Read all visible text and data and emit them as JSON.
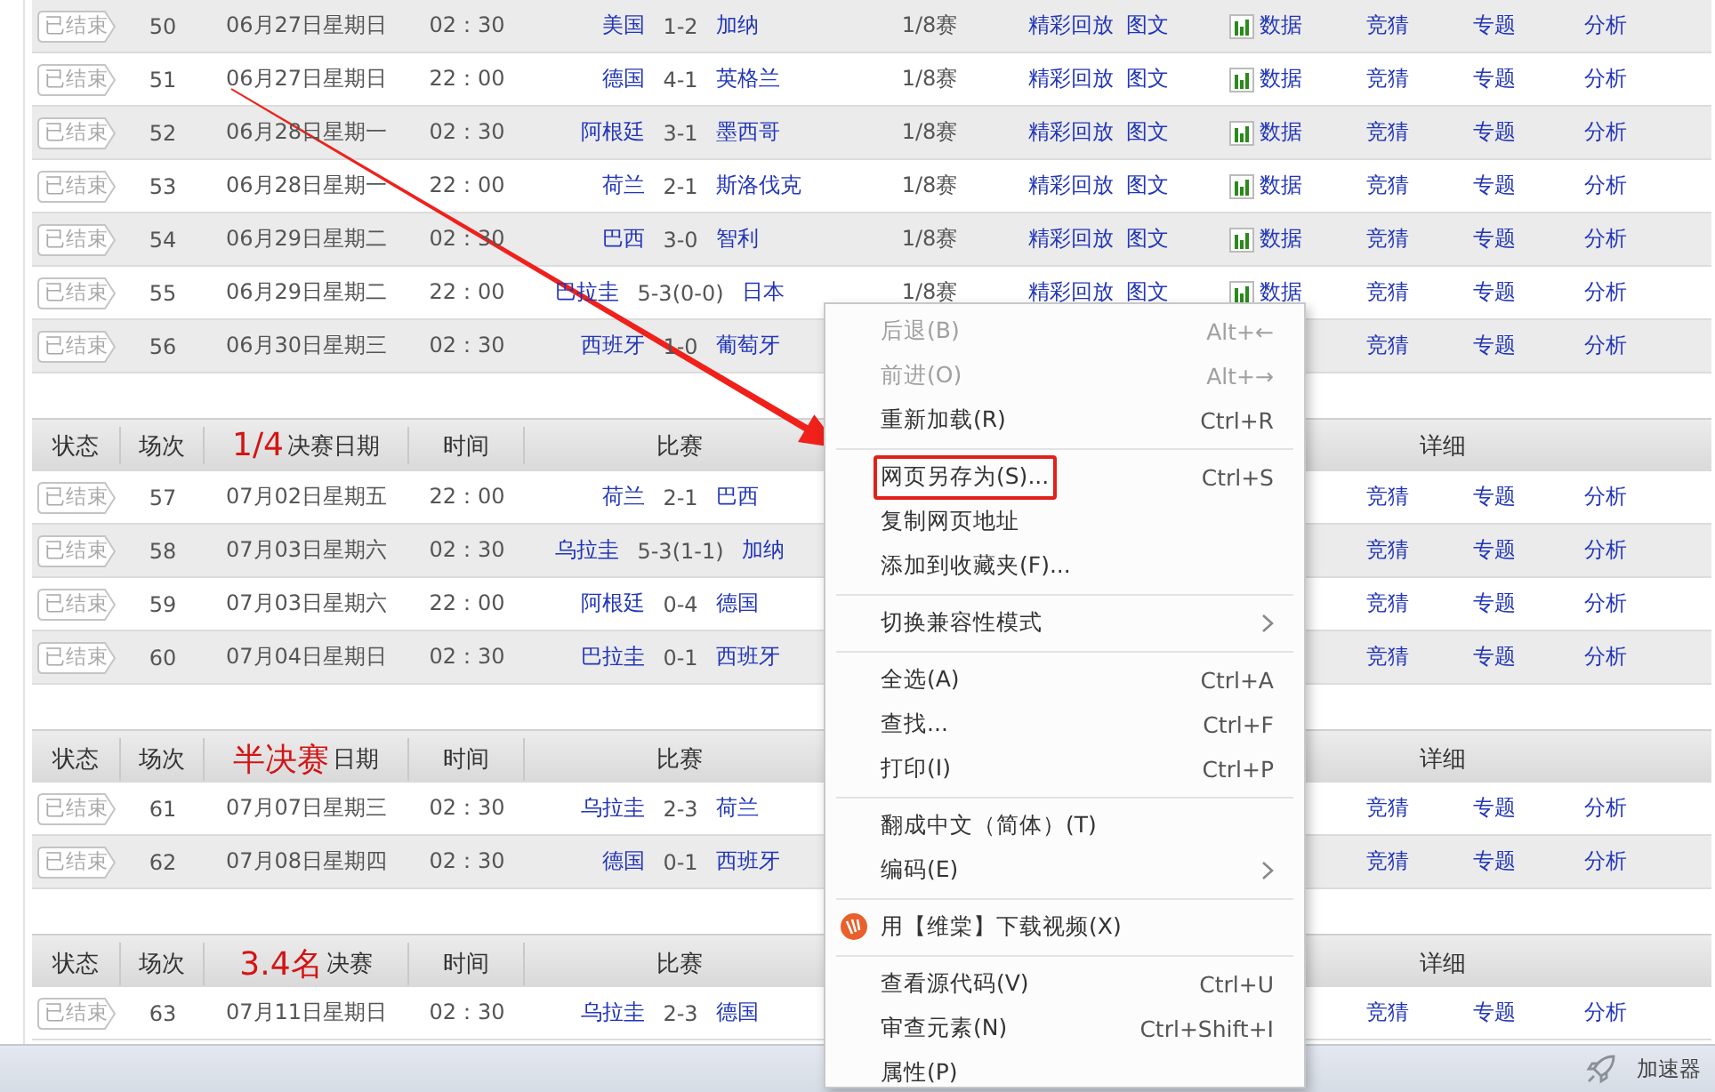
{
  "sections": [
    {
      "rows": [
        {
          "status": "已结束",
          "number": "50",
          "date": "06月27日星期日",
          "time": "02：30",
          "home": "美国",
          "score": "1-2",
          "away": "加纳",
          "round": "1/8赛",
          "replay": "精彩回放",
          "report": "图文",
          "stats": "数据",
          "quiz": "竞猜",
          "topic": "专题",
          "analysis": "分析",
          "shaded": true
        },
        {
          "status": "已结束",
          "number": "51",
          "date": "06月27日星期日",
          "time": "22：00",
          "home": "德国",
          "score": "4-1",
          "away": "英格兰",
          "round": "1/8赛",
          "replay": "精彩回放",
          "report": "图文",
          "stats": "数据",
          "quiz": "竞猜",
          "topic": "专题",
          "analysis": "分析",
          "shaded": false
        },
        {
          "status": "已结束",
          "number": "52",
          "date": "06月28日星期一",
          "time": "02：30",
          "home": "阿根廷",
          "score": "3-1",
          "away": "墨西哥",
          "round": "1/8赛",
          "replay": "精彩回放",
          "report": "图文",
          "stats": "数据",
          "quiz": "竞猜",
          "topic": "专题",
          "analysis": "分析",
          "shaded": true
        },
        {
          "status": "已结束",
          "number": "53",
          "date": "06月28日星期一",
          "time": "22：00",
          "home": "荷兰",
          "score": "2-1",
          "away": "斯洛伐克",
          "round": "1/8赛",
          "replay": "精彩回放",
          "report": "图文",
          "stats": "数据",
          "quiz": "竞猜",
          "topic": "专题",
          "analysis": "分析",
          "shaded": false
        },
        {
          "status": "已结束",
          "number": "54",
          "date": "06月29日星期二",
          "time": "02：30",
          "home": "巴西",
          "score": "3-0",
          "away": "智利",
          "round": "1/8赛",
          "replay": "精彩回放",
          "report": "图文",
          "stats": "数据",
          "quiz": "竞猜",
          "topic": "专题",
          "analysis": "分析",
          "shaded": true
        },
        {
          "status": "已结束",
          "number": "55",
          "date": "06月29日星期二",
          "time": "22：00",
          "home": "巴拉圭",
          "score": "5-3(0-0)",
          "away": "日本",
          "round": "1/8赛",
          "replay": "精彩回放",
          "report": "图文",
          "stats": "数据",
          "quiz": "竞猜",
          "topic": "专题",
          "analysis": "分析",
          "shaded": false
        },
        {
          "status": "已结束",
          "number": "56",
          "date": "06月30日星期三",
          "time": "02：30",
          "home": "西班牙",
          "score": "1-0",
          "away": "葡萄牙",
          "quiz": "竞猜",
          "topic": "专题",
          "analysis": "分析",
          "shaded": true
        }
      ]
    },
    {
      "header": {
        "status": "状态",
        "number": "场次",
        "stage": "1/4",
        "date": "决赛日期",
        "time": "时间",
        "match": "比赛",
        "detail": "详细"
      },
      "rows": [
        {
          "status": "已结束",
          "number": "57",
          "date": "07月02日星期五",
          "time": "22：00",
          "home": "荷兰",
          "score": "2-1",
          "away": "巴西",
          "quiz": "竞猜",
          "topic": "专题",
          "analysis": "分析",
          "shaded": false
        },
        {
          "status": "已结束",
          "number": "58",
          "date": "07月03日星期六",
          "time": "02：30",
          "home": "乌拉圭",
          "score": "5-3(1-1)",
          "away": "加纳",
          "quiz": "竞猜",
          "topic": "专题",
          "analysis": "分析",
          "shaded": true
        },
        {
          "status": "已结束",
          "number": "59",
          "date": "07月03日星期六",
          "time": "22：00",
          "home": "阿根廷",
          "score": "0-4",
          "away": "德国",
          "quiz": "竞猜",
          "topic": "专题",
          "analysis": "分析",
          "shaded": false
        },
        {
          "status": "已结束",
          "number": "60",
          "date": "07月04日星期日",
          "time": "02：30",
          "home": "巴拉圭",
          "score": "0-1",
          "away": "西班牙",
          "quiz": "竞猜",
          "topic": "专题",
          "analysis": "分析",
          "shaded": true
        }
      ]
    },
    {
      "header": {
        "status": "状态",
        "number": "场次",
        "stage": "半决赛",
        "date": "日期",
        "time": "时间",
        "match": "比赛",
        "detail": "详细"
      },
      "rows": [
        {
          "status": "已结束",
          "number": "61",
          "date": "07月07日星期三",
          "time": "02：30",
          "home": "乌拉圭",
          "score": "2-3",
          "away": "荷兰",
          "quiz": "竞猜",
          "topic": "专题",
          "analysis": "分析",
          "shaded": false
        },
        {
          "status": "已结束",
          "number": "62",
          "date": "07月08日星期四",
          "time": "02：30",
          "home": "德国",
          "score": "0-1",
          "away": "西班牙",
          "quiz": "竞猜",
          "topic": "专题",
          "analysis": "分析",
          "shaded": true
        }
      ]
    },
    {
      "header": {
        "status": "状态",
        "number": "场次",
        "stage": "3.4名",
        "date": "决赛",
        "time": "时间",
        "match": "比赛",
        "detail": "详细"
      },
      "rows": [
        {
          "status": "已结束",
          "number": "63",
          "date": "07月11日星期日",
          "time": "02：30",
          "home": "乌拉圭",
          "score": "2-3",
          "away": "德国",
          "quiz": "竞猜",
          "topic": "专题",
          "analysis": "分析",
          "shaded": false
        }
      ]
    }
  ],
  "context_menu": {
    "items": [
      {
        "kind": "item",
        "label": "后退(B)",
        "shortcut": "Alt+←",
        "disabled": true,
        "submenu": false,
        "annotated": false
      },
      {
        "kind": "item",
        "label": "前进(O)",
        "shortcut": "Alt+→",
        "disabled": true,
        "submenu": false,
        "annotated": false
      },
      {
        "kind": "item",
        "label": "重新加载(R)",
        "shortcut": "Ctrl+R",
        "disabled": false,
        "submenu": false,
        "annotated": false
      },
      {
        "kind": "separator"
      },
      {
        "kind": "item",
        "label": "网页另存为(S)...",
        "shortcut": "Ctrl+S",
        "disabled": false,
        "submenu": false,
        "annotated": true
      },
      {
        "kind": "item",
        "label": "复制网页地址",
        "disabled": false,
        "submenu": false,
        "annotated": false
      },
      {
        "kind": "item",
        "label": "添加到收藏夹(F)...",
        "disabled": false,
        "submenu": false,
        "annotated": false
      },
      {
        "kind": "separator"
      },
      {
        "kind": "item",
        "label": "切换兼容性模式",
        "disabled": false,
        "submenu": true,
        "annotated": false
      },
      {
        "kind": "separator"
      },
      {
        "kind": "item",
        "label": "全选(A)",
        "shortcut": "Ctrl+A",
        "disabled": false,
        "submenu": false,
        "annotated": false
      },
      {
        "kind": "item",
        "label": "查找...",
        "shortcut": "Ctrl+F",
        "disabled": false,
        "submenu": false,
        "annotated": false
      },
      {
        "kind": "item",
        "label": "打印(I)",
        "shortcut": "Ctrl+P",
        "disabled": false,
        "submenu": false,
        "annotated": false
      },
      {
        "kind": "separator"
      },
      {
        "kind": "item",
        "label": "翻成中文（简体）(T)",
        "disabled": false,
        "submenu": false,
        "annotated": false
      },
      {
        "kind": "item",
        "label": "编码(E)",
        "disabled": false,
        "submenu": true,
        "annotated": false
      },
      {
        "kind": "separator"
      },
      {
        "kind": "app",
        "label": "用【维棠】下载视频(X)",
        "disabled": false,
        "submenu": false,
        "annotated": false
      },
      {
        "kind": "separator"
      },
      {
        "kind": "item",
        "label": "查看源代码(V)",
        "shortcut": "Ctrl+U",
        "disabled": false,
        "submenu": false,
        "annotated": false
      },
      {
        "kind": "item",
        "label": "审查元素(N)",
        "shortcut": "Ctrl+Shift+I",
        "disabled": false,
        "submenu": false,
        "annotated": false
      },
      {
        "kind": "item",
        "label": "属性(P)",
        "disabled": false,
        "submenu": false,
        "annotated": false
      }
    ]
  },
  "annotations": [
    {
      "kind": "arrow"
    }
  ],
  "status_bar": {
    "accelerator": "加速器"
  }
}
